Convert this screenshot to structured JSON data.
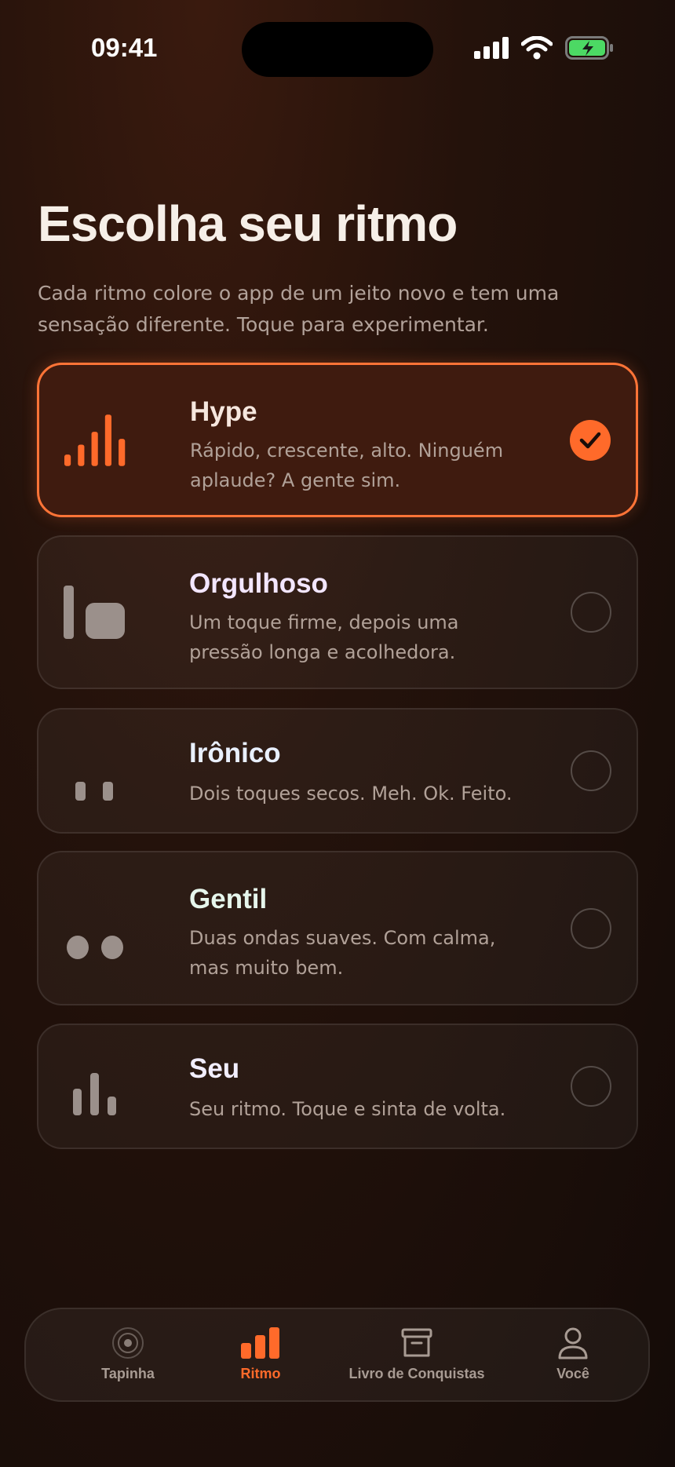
{
  "status_bar": {
    "time": "09:41"
  },
  "header": {
    "title": "Escolha seu ritmo",
    "subtitle": "Cada ritmo colore o app de um jeito novo e tem uma sensação diferente. Toque para experimentar."
  },
  "rhythms": [
    {
      "name": "Hype",
      "description": "Rápido, crescente, alto. Ninguém aplaude? A gente sim.",
      "selected": true,
      "name_color": "#f6e7de"
    },
    {
      "name": "Orgulhoso",
      "description": "Um toque firme, depois uma pressão longa e acolhedora.",
      "selected": false,
      "name_color": "#f3e6ff"
    },
    {
      "name": "Irônico",
      "description": "Dois toques secos. Meh. Ok. Feito.",
      "selected": false,
      "name_color": "#e9f0ff"
    },
    {
      "name": "Gentil",
      "description": "Duas ondas suaves. Com calma, mas muito bem.",
      "selected": false,
      "name_color": "#e6f6ec"
    },
    {
      "name": "Seu",
      "description": "Seu ritmo. Toque e sinta de volta.",
      "selected": false,
      "name_color": "#f2eeff"
    }
  ],
  "tabs": [
    {
      "label": "Tapinha",
      "icon": "radar-icon",
      "active": false
    },
    {
      "label": "Ritmo",
      "icon": "bars-icon",
      "active": true
    },
    {
      "label": "Livro de Conquistas",
      "icon": "archive-box-icon",
      "active": false
    },
    {
      "label": "Você",
      "icon": "person-icon",
      "active": false
    }
  ],
  "colors": {
    "accent": "#ff6a2a",
    "background": "#1a0d08"
  }
}
